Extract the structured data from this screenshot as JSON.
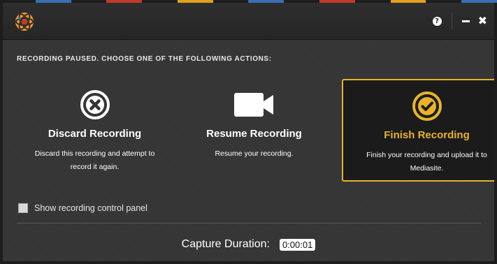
{
  "colors": {
    "accent": "#e8b32a",
    "background": "#353535",
    "titlebar": "#2a2a2a"
  },
  "titlebar": {
    "logo_icon": "mediasite-logo-icon",
    "help_label": "?",
    "minimize_icon": "minimize-icon",
    "close_icon": "close-icon"
  },
  "prompt": "RECORDING PAUSED. CHOOSE ONE OF THE FOLLOWING ACTIONS:",
  "actions": [
    {
      "icon": "discard-circle-x-icon",
      "title": "Discard Recording",
      "description": "Discard this recording and attempt to record it again.",
      "selected": false
    },
    {
      "icon": "video-camera-icon",
      "title": "Resume Recording",
      "description": "Resume your recording.",
      "selected": false
    },
    {
      "icon": "check-circle-icon",
      "title": "Finish Recording",
      "description": "Finish your recording and upload it to Mediasite.",
      "selected": true
    }
  ],
  "control_panel": {
    "label": "Show recording control panel",
    "checked": false
  },
  "capture": {
    "label": "Capture Duration:",
    "value": "0:00:01"
  }
}
